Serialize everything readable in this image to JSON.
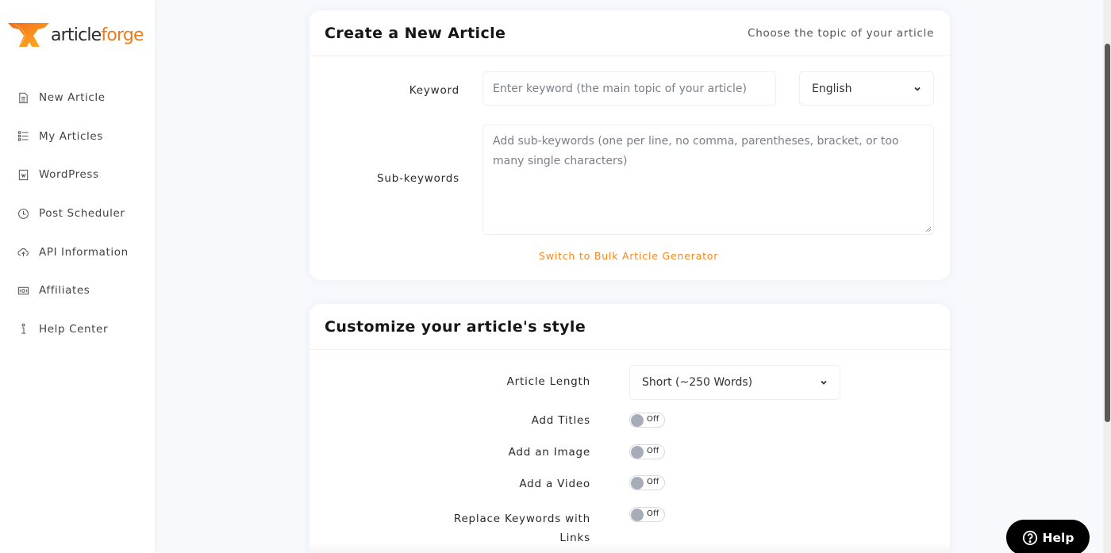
{
  "brand": {
    "name_part1": "article",
    "name_part2": "forge",
    "accent_color": "#f27a1a"
  },
  "sidebar": {
    "items": [
      {
        "label": "New Article",
        "icon": "document-icon"
      },
      {
        "label": "My Articles",
        "icon": "list-icon"
      },
      {
        "label": "WordPress",
        "icon": "wordpress-icon"
      },
      {
        "label": "Post Scheduler",
        "icon": "clock-icon"
      },
      {
        "label": "API Information",
        "icon": "cloud-upload-icon"
      },
      {
        "label": "Affiliates",
        "icon": "money-icon"
      },
      {
        "label": "Help Center",
        "icon": "info-icon"
      }
    ]
  },
  "create_card": {
    "title": "Create a New Article",
    "subtitle": "Choose the topic of your article",
    "keyword_label": "Keyword",
    "keyword_placeholder": "Enter keyword (the main topic of your article)",
    "language_selected": "English",
    "subkeywords_label": "Sub-keywords",
    "subkeywords_placeholder": "Add sub-keywords (one per line, no comma, parentheses, bracket, or too many single characters)",
    "bulk_link": "Switch to Bulk Article Generator"
  },
  "style_card": {
    "title": "Customize your article's style",
    "article_length_label": "Article Length",
    "article_length_selected": "Short (~250 Words)",
    "toggles": [
      {
        "label": "Add Titles",
        "state": "Off"
      },
      {
        "label": "Add an Image",
        "state": "Off"
      },
      {
        "label": "Add a Video",
        "state": "Off"
      },
      {
        "label": "Replace Keywords with Links",
        "state": "Off"
      }
    ]
  },
  "help_button": {
    "label": "Help"
  }
}
